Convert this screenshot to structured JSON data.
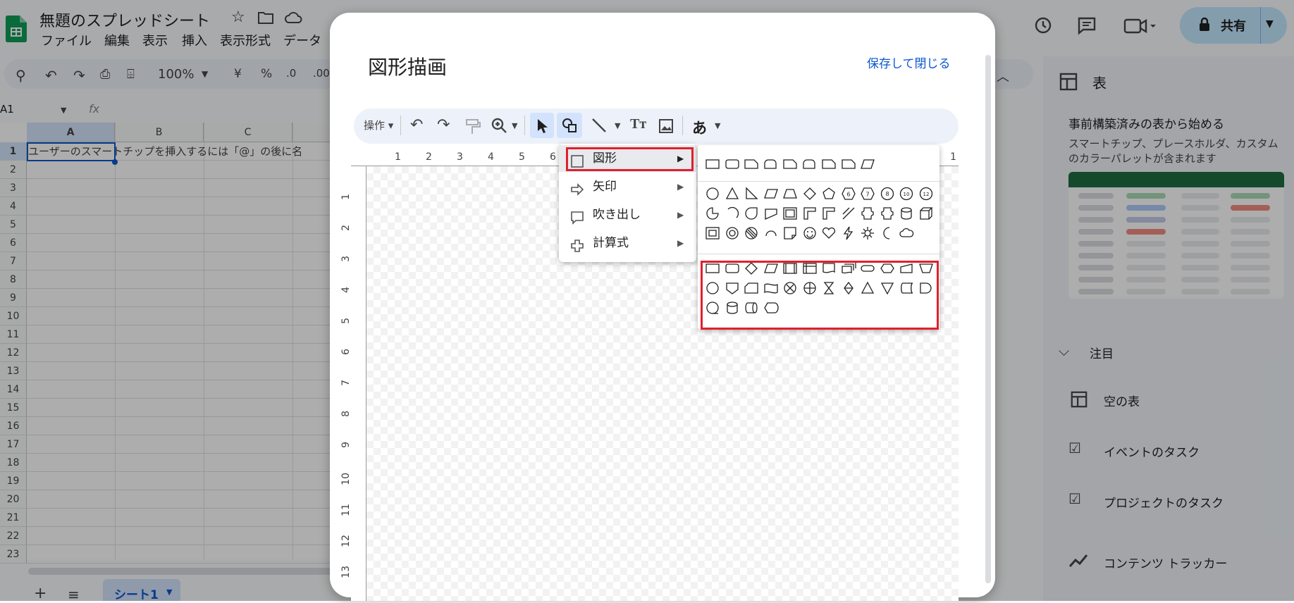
{
  "sheet": {
    "title": "無題のスプレッドシート",
    "menus": [
      "ファイル",
      "編集",
      "表示",
      "挿入",
      "表示形式",
      "データ"
    ],
    "zoom": "100%",
    "currency": "¥",
    "percent": "%",
    "dec_dec": ".0",
    "dec_inc": ".00",
    "cell_ref": "A1",
    "fx": "fx",
    "columns": [
      "A",
      "B",
      "C"
    ],
    "rows": [
      "1",
      "2",
      "3",
      "4",
      "5",
      "6",
      "7",
      "8",
      "9",
      "10",
      "11",
      "12",
      "13",
      "14",
      "15",
      "16",
      "17",
      "18",
      "19",
      "20",
      "21",
      "22",
      "23"
    ],
    "cell_a1": "ユーザーのスマートチップを挿入するには「@」の後に名",
    "share_label": "共有",
    "sheet_tab": "シート1"
  },
  "side_panel": {
    "title": "表",
    "prebuilt_heading": "事前構築済みの表から始める",
    "prebuilt_desc": "スマートチップ、プレースホルダ、カスタムのカラーパレットが含まれます",
    "featured_label": "注目",
    "items": [
      "空の表",
      "イベントのタスク",
      "プロジェクトのタスク",
      "コンテンツ トラッカー"
    ],
    "preview_accent": "#1e6c41",
    "chip_colors": [
      "#a8dab5",
      "#aecbfa",
      "#c5cae9",
      "#f28b82"
    ]
  },
  "dialog": {
    "title": "図形描画",
    "save_close": "保存して閉じる",
    "actions_label": "操作",
    "jp_char": "あ",
    "ruler_h": [
      "1",
      "2",
      "3",
      "4",
      "5",
      "6",
      "1"
    ],
    "ruler_v": [
      "1",
      "2",
      "3",
      "4",
      "5",
      "6",
      "7",
      "8",
      "9",
      "10",
      "11",
      "12",
      "13"
    ]
  },
  "shape_menu": {
    "items": [
      {
        "label": "図形",
        "icon": "square-icon"
      },
      {
        "label": "矢印",
        "icon": "arrow-icon"
      },
      {
        "label": "吹き出し",
        "icon": "callout-icon"
      },
      {
        "label": "計算式",
        "icon": "plus-icon"
      }
    ],
    "arrow": "▶",
    "numbered": [
      "6",
      "7",
      "8",
      "10",
      "12"
    ]
  },
  "colors": {
    "accent": "#0b57d0",
    "highlight_red": "#e0202e",
    "selected_tool": "#d3e3fd"
  }
}
